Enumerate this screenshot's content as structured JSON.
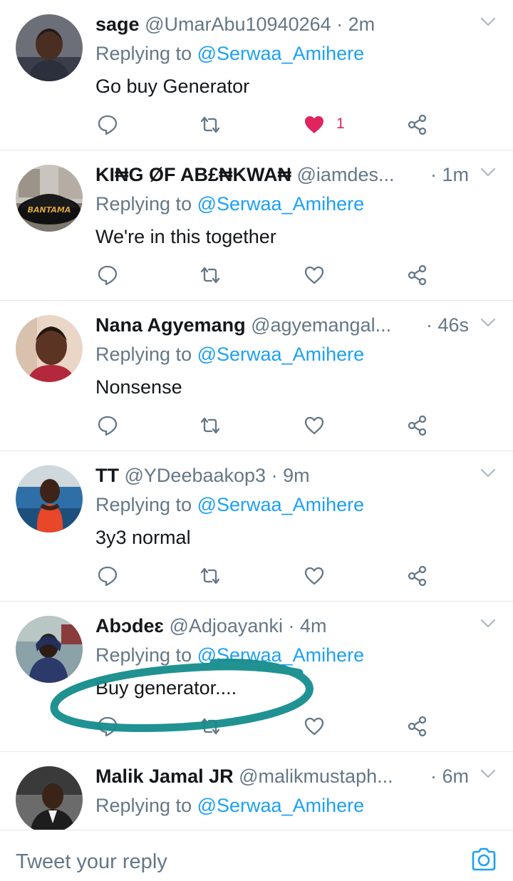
{
  "colors": {
    "accent": "#1da1f2",
    "like": "#e0245e",
    "muted": "#657786",
    "divider": "#e1e8ed",
    "annotation": "#138a8a"
  },
  "tweets": [
    {
      "name": "sage",
      "handle": "@UmarAbu10940264",
      "separator": " · ",
      "time": "2m",
      "reply_prefix": "Replying to ",
      "reply_to": "@Serwaa_Amihere",
      "text": "Go buy Generator",
      "liked": true,
      "like_count": "1"
    },
    {
      "name": "KI₦G ØF AB£₦KWA₦",
      "handle": "@iamdes...",
      "separator": " · ",
      "time": "1m",
      "reply_prefix": "Replying to ",
      "reply_to": "@Serwaa_Amihere",
      "text": "We're in this together",
      "avatar_text": "BANTAMA"
    },
    {
      "name": "Nana Agyemang",
      "handle": "@agyemangal...",
      "separator": " · ",
      "time": "46s",
      "reply_prefix": "Replying to ",
      "reply_to": "@Serwaa_Amihere",
      "text": "Nonsense"
    },
    {
      "name": "TT",
      "handle": "@YDeebaakop3",
      "separator": " · ",
      "time": "9m",
      "reply_prefix": "Replying to ",
      "reply_to": "@Serwaa_Amihere",
      "text": "3y3 normal"
    },
    {
      "name": "Abɔdeɛ",
      "handle": "@Adjoayanki",
      "separator": " · ",
      "time": "4m",
      "reply_prefix": "Replying to ",
      "reply_to": "@Serwaa_Amihere",
      "text": "Buy generator...."
    },
    {
      "name": "Malik Jamal JR",
      "handle": "@malikmustaph...",
      "separator": " · ",
      "time": "6m",
      "reply_prefix": "Replying to ",
      "reply_to": "@Serwaa_Amihere"
    }
  ],
  "icons": {
    "reply": "reply-bubble-icon",
    "retweet": "retweet-icon",
    "like": "heart-icon",
    "share": "share-icon",
    "more": "chevron-down-icon",
    "camera": "camera-icon"
  },
  "composer": {
    "placeholder": "Tweet your reply"
  }
}
